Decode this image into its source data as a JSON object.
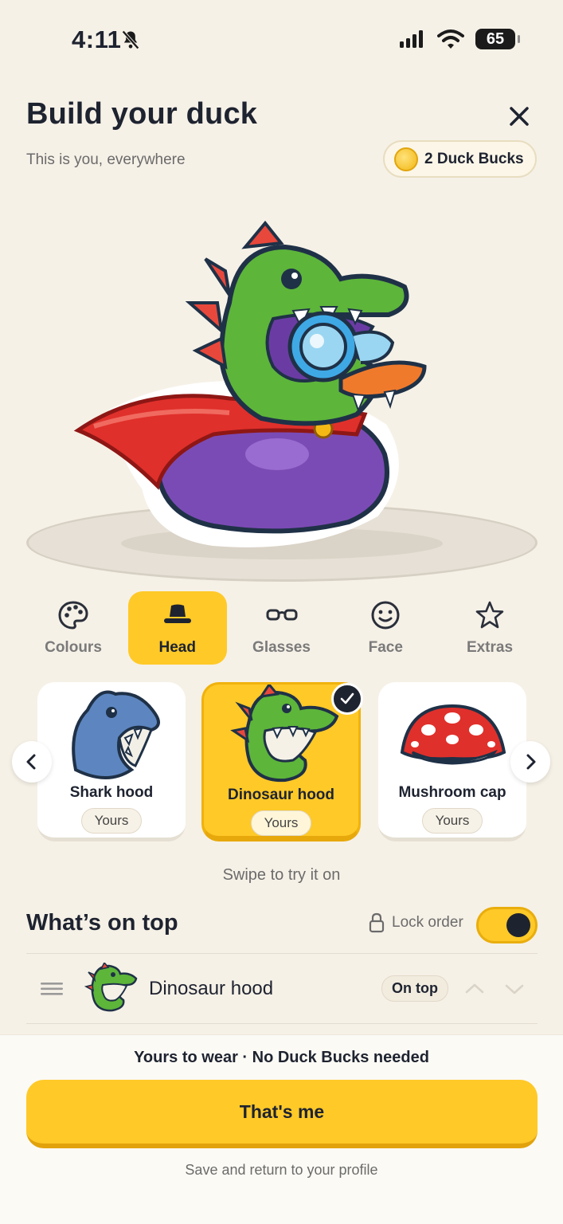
{
  "status": {
    "time": "4:11",
    "battery": "65"
  },
  "header": {
    "title": "Build your duck",
    "subtitle": "This is you, everywhere",
    "bucks_label": "2 Duck Bucks"
  },
  "tabs": [
    {
      "label": "Colours",
      "icon": "palette-icon"
    },
    {
      "label": "Head",
      "icon": "hat-icon",
      "active": true
    },
    {
      "label": "Glasses",
      "icon": "glasses-icon"
    },
    {
      "label": "Face",
      "icon": "smiley-icon"
    },
    {
      "label": "Extras",
      "icon": "star-icon"
    }
  ],
  "items": [
    {
      "name": "Shark hood",
      "status": "Yours"
    },
    {
      "name": "Dinosaur hood",
      "status": "Yours",
      "selected": true
    },
    {
      "name": "Mushroom cap",
      "status": "Yours"
    }
  ],
  "swipe_hint": "Swipe to try it on",
  "layers": {
    "title": "What’s on top",
    "lock_label": "Lock order",
    "lock_on": true,
    "rows": [
      {
        "name": "Dinosaur hood",
        "badge": "On top"
      }
    ]
  },
  "footer": {
    "note": "Yours to wear · No Duck Bucks needed",
    "cta": "That's me",
    "sub": "Save and return to your profile"
  },
  "colors": {
    "accent": "#FFC928",
    "background": "#F6F1E7",
    "text": "#1E2330",
    "duck_body": "#7B4BB5",
    "dino_green": "#5DB53A",
    "cape_red": "#E0302B"
  }
}
